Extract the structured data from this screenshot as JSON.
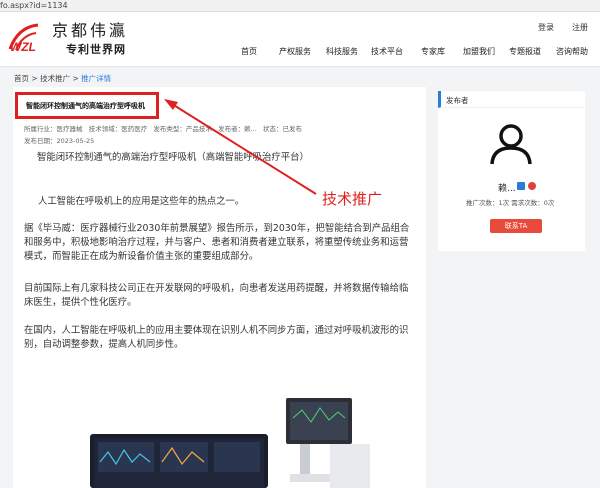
{
  "url": "fo.aspx?id=1134",
  "site": {
    "name_cn": "京都伟瀛",
    "logo_letters": "WZL",
    "subtitle": "专利世界网"
  },
  "toplinks": {
    "login": "登录",
    "register": "注册"
  },
  "nav": [
    "首页",
    "产权服务",
    "科技服务",
    "技术平台",
    "专家库",
    "加盟我们",
    "专题报道",
    "咨询帮助"
  ],
  "breadcrumb": {
    "home": "首页",
    "sep": ">",
    "section": "技术推广",
    "current": "推广详情"
  },
  "article": {
    "title": "智能闭环控制通气的高端治疗型呼吸机",
    "meta": {
      "industry": "所属行业：医疗器械",
      "field": "技术领域：医药医疗",
      "type": "发布类型：产品技术",
      "publisher": "发布者：赖...",
      "status": "状态：已发布"
    },
    "date": "发布日期：2023-05-25",
    "paragraphs": [
      "智能闭环控制通气的高端治疗型呼吸机（高端智能呼吸治疗平台）",
      "人工智能在呼吸机上的应用是这些年的热点之一。",
      "据《毕马威：医疗器械行业2030年前景展望》报告所示，到2030年，把智能结合到产品组合和服务中，积极地影响治疗过程，并与客户、患者和消费者建立联系，将重塑传统业务和运营模式，而智能正在成为新设备价值主张的重要组成部分。",
      "目前国际上有几家科技公司正在开发联网的呼吸机，向患者发送用药提醒，并将数据传输给临床医生，提供个性化医疗。",
      "在国内，人工智能在呼吸机上的应用主要体现在识别人机不同步方面，通过对呼吸机波形的识别，自动调整参数，提高人机同步性。"
    ]
  },
  "annotation": {
    "label": "技术推广",
    "color": "#e02020"
  },
  "sidebar": {
    "header": "发布者",
    "name": "赖...",
    "stats": "推广次数：1次  需求次数：0次",
    "contact_button": "联系TA"
  },
  "colors": {
    "accent": "#2a7cd6",
    "annotation_red": "#e02020",
    "button": "#e84b3c"
  }
}
